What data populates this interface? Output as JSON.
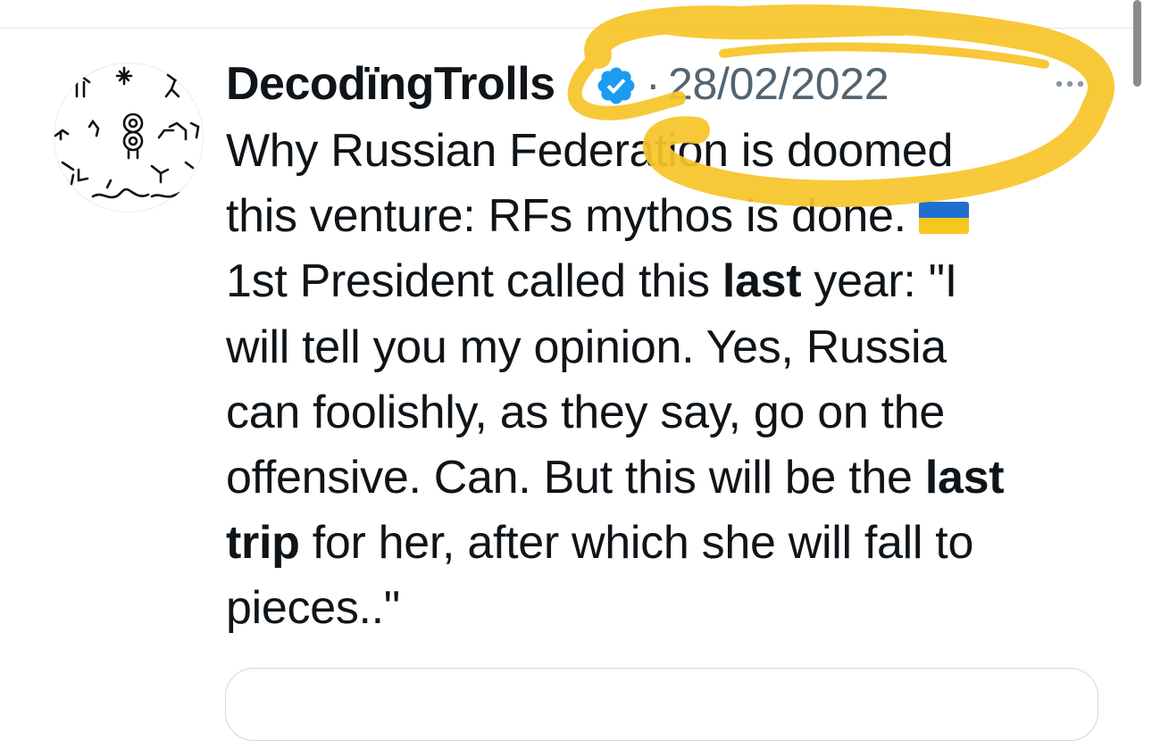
{
  "tweet": {
    "author": {
      "display_name": "DecodïngTrolls",
      "verified_icon": "verified-badge-icon"
    },
    "separator": "·",
    "date": "28/02/2022",
    "more_icon": "more-options-icon",
    "text_lines": [
      [
        {
          "t": "Why Russian Federation is doomed "
        }
      ],
      [
        {
          "t": "this venture: RFs mythos is done. "
        },
        {
          "flag": "ukraine-flag-emoji"
        }
      ],
      [
        {
          "t": "1st President called this "
        },
        {
          "t": "last",
          "b": true
        },
        {
          "t": " year: \"I"
        }
      ],
      [
        {
          "t": "will tell you my opinion. Yes, Russia"
        }
      ],
      [
        {
          "t": "can foolishly, as they say, go on the"
        }
      ],
      [
        {
          "t": "offensive. Can. But this will be the "
        },
        {
          "t": "last",
          "b": true
        }
      ],
      [
        {
          "t": "trip",
          "b": true
        },
        {
          "t": " for her, after which she will fall to"
        }
      ],
      [
        {
          "t": "pieces..\""
        }
      ]
    ]
  },
  "annotation": {
    "type": "yellow-circle-highlight",
    "color": "#f7c52b"
  },
  "colors": {
    "text": "#0f1419",
    "secondary": "#536471",
    "verified": "#1d9bf0",
    "divider": "#dfe3e6"
  }
}
